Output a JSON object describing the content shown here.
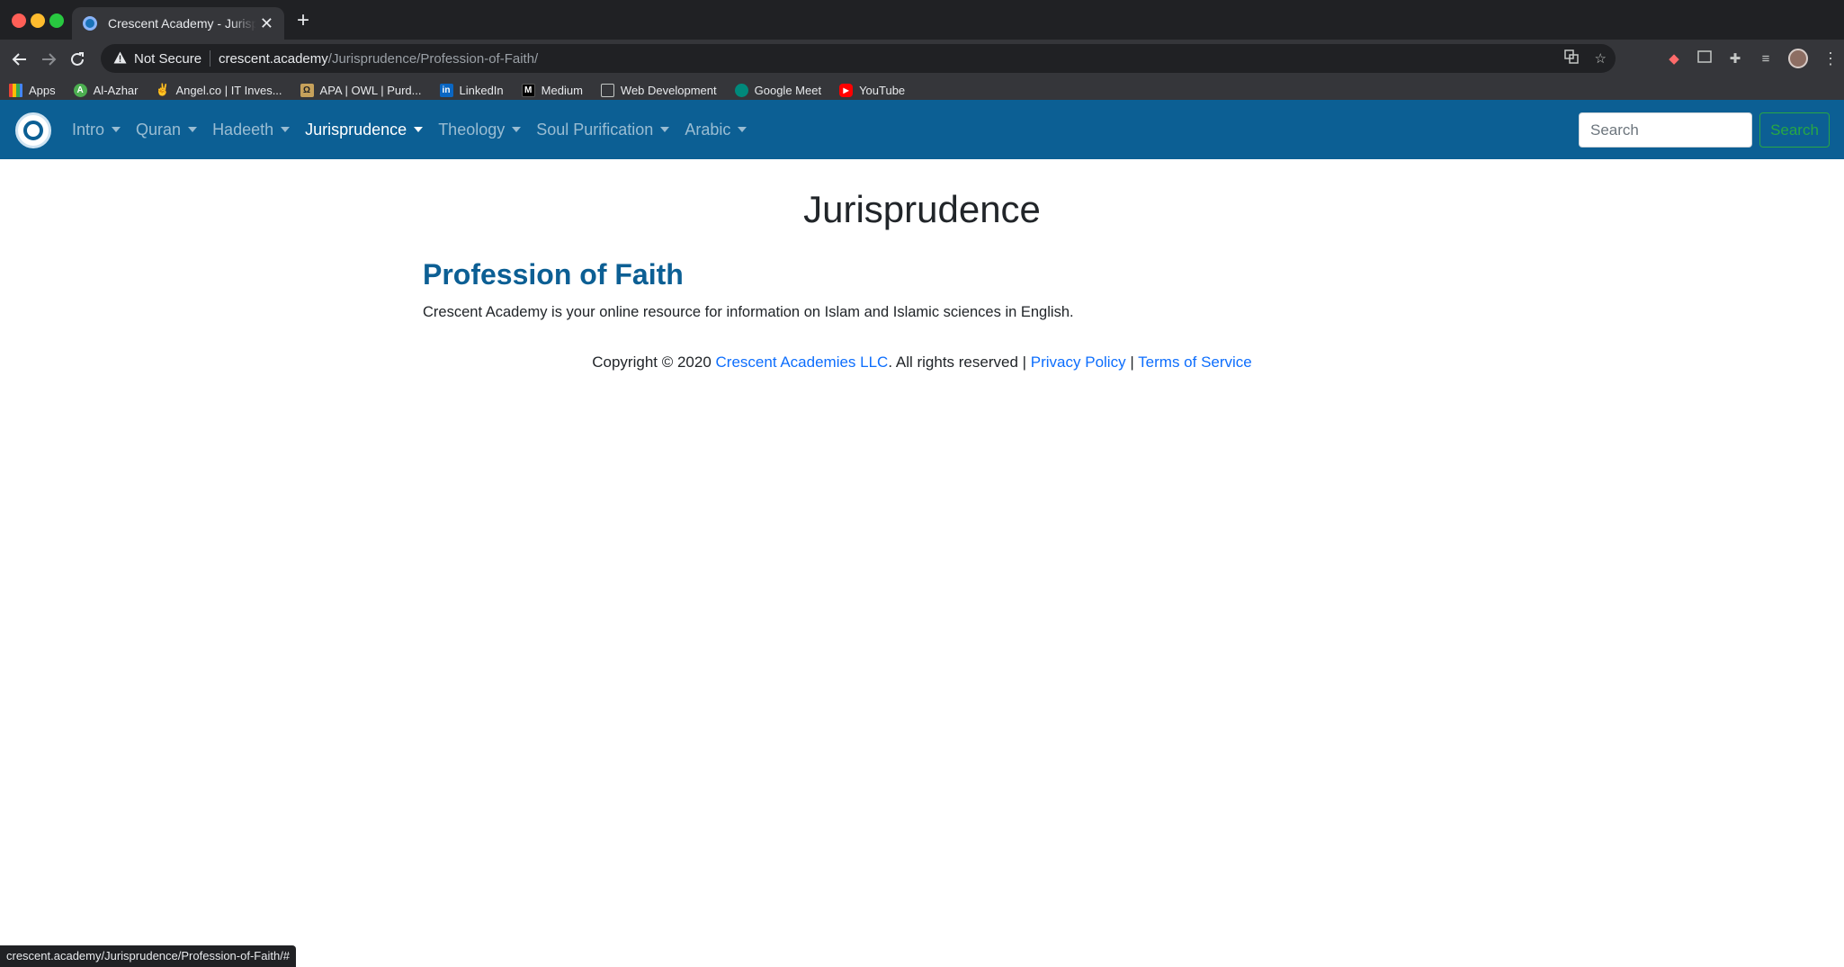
{
  "browser": {
    "tab_title": "Crescent Academy - Jurisprudence",
    "tab_close": "✕",
    "new_tab": "+",
    "security_label": "Not Secure",
    "url_host": "crescent.academy",
    "url_path": "/Jurisprudence/Profession-of-Faith/",
    "bookmarks": [
      {
        "label": "Apps",
        "icon": "apps-grid-icon"
      },
      {
        "label": "Al-Azhar",
        "icon": "al-azhar-icon"
      },
      {
        "label": "Angel.co | IT Inves...",
        "icon": "angel-icon"
      },
      {
        "label": "APA | OWL | Purd...",
        "icon": "owl-icon"
      },
      {
        "label": "LinkedIn",
        "icon": "linkedin-icon"
      },
      {
        "label": "Medium",
        "icon": "medium-icon"
      },
      {
        "label": "Web Development",
        "icon": "folder-icon"
      },
      {
        "label": "Google Meet",
        "icon": "google-meet-icon"
      },
      {
        "label": "YouTube",
        "icon": "youtube-icon"
      }
    ],
    "status_url": "crescent.academy/Jurisprudence/Profession-of-Faith/#"
  },
  "site_nav": {
    "menu": [
      {
        "label": "Intro",
        "active": false
      },
      {
        "label": "Quran",
        "active": false
      },
      {
        "label": "Hadeeth",
        "active": false
      },
      {
        "label": "Jurisprudence",
        "active": true
      },
      {
        "label": "Theology",
        "active": false
      },
      {
        "label": "Soul Purification",
        "active": false
      },
      {
        "label": "Arabic",
        "active": false
      }
    ],
    "search_placeholder": "Search",
    "search_button": "Search"
  },
  "page": {
    "title": "Jurisprudence",
    "article_title": "Profession of Faith",
    "article_body": "Crescent Academy is your online resource for information on Islam and Islamic sciences in English."
  },
  "footer": {
    "copyright_prefix": "Copyright © 2020",
    "company_link": "Crescent Academies LLC",
    "rights_text": ". All rights reserved |",
    "privacy_link": "Privacy Policy",
    "separator": "|",
    "terms_link": "Terms of Service"
  },
  "colors": {
    "nav_background": "#0c5f94",
    "article_title": "#0c5f94",
    "link": "#0d6efd",
    "search_button": "#28a745"
  }
}
